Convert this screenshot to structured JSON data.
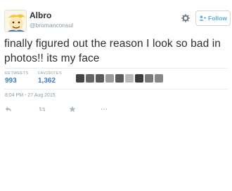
{
  "tweet": {
    "display_name": "Albro",
    "handle": "@bromanconsul",
    "text": "finally figured out the reason I look so bad in photos!! its my face",
    "timestamp": "8:04 PM - 27 Aug 2015"
  },
  "header": {
    "follow_label": "Follow",
    "settings_icon": "gear-icon",
    "follow_icon": "add-person-icon"
  },
  "stats": {
    "retweets_label": "RETWEETS",
    "retweets_count": "993",
    "favorites_label": "FAVORITES",
    "favorites_count": "1,362"
  },
  "favoriter_avatars": [
    "#444",
    "#666",
    "#5a5a5a",
    "#9a9a9a",
    "#5c5c5c",
    "#b8b8b8",
    "#3c3c3c",
    "#7a7a7a",
    "#888"
  ],
  "actions": [
    "reply-icon",
    "retweet-icon",
    "favorite-star-icon",
    "more-icon"
  ],
  "colors": {
    "link_blue": "#3b7ebf",
    "follow_blue": "#55acee",
    "muted": "#8899a6",
    "text": "#292f33"
  }
}
